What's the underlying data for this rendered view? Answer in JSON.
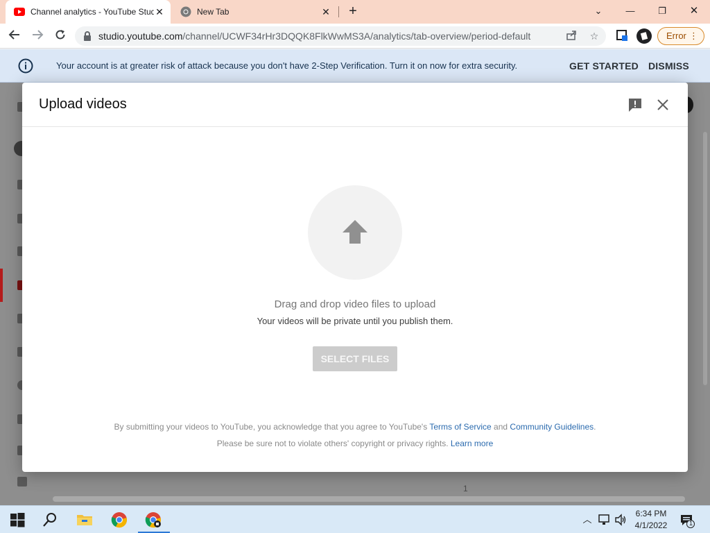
{
  "browser": {
    "tabs": [
      {
        "title": "Channel analytics - YouTube Studio",
        "favicon": "youtube-icon",
        "active": true
      },
      {
        "title": "New Tab",
        "favicon": "chrome-icon",
        "active": false
      }
    ],
    "url_host": "studio.youtube.com",
    "url_path": "/channel/UCWF34rHr3DQQK8FlkWwMS3A/analytics/tab-overview/period-default",
    "error_label": "Error"
  },
  "banner": {
    "message": "Your account is at greater risk of attack because you don't have 2-Step Verification. Turn it on now for extra security.",
    "get_started": "GET STARTED",
    "dismiss": "DISMISS"
  },
  "background": {
    "page_number": "1"
  },
  "dialog": {
    "title": "Upload videos",
    "drag_drop": "Drag and drop video files to upload",
    "private_note": "Your videos will be private until you publish them.",
    "select_button": "SELECT FILES",
    "terms_prefix": "By submitting your videos to YouTube, you acknowledge that you agree to YouTube's",
    "terms_link": "Terms of Service",
    "terms_and": "and",
    "guidelines_link": "Community Guidelines",
    "terms_suffix": ".",
    "privacy_text": "Please be sure not to violate others' copyright or privacy rights.",
    "learn_more": "Learn more"
  },
  "taskbar": {
    "time": "6:34 PM",
    "date": "4/1/2022",
    "notification_count": "1"
  },
  "colors": {
    "tabstrip": "#f9d7c8",
    "banner": "#dbe7f6",
    "link": "#2a6aae",
    "select_button_disabled": "#cccccc",
    "taskbar": "#d9e9f7"
  }
}
